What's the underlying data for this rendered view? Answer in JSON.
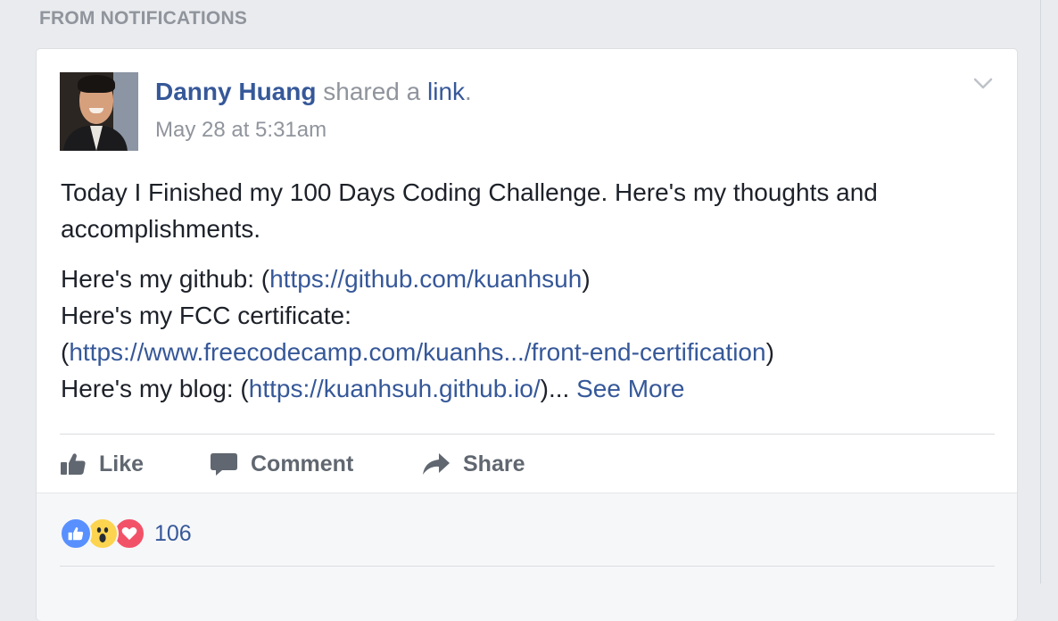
{
  "section": {
    "label": "FROM NOTIFICATIONS"
  },
  "post": {
    "author": "Danny Huang",
    "action_text": "shared a",
    "action_link": "link",
    "action_end": ".",
    "timestamp": "May 28 at 5:31am",
    "paragraph_1": "Today I Finished my 100 Days Coding Challenge. Here's my thoughts and accomplishments.",
    "line_github_prefix": "Here's my github: (",
    "github_url": "https://github.com/kuanhsuh",
    "line_github_suffix": ")",
    "line_fcc_prefix": "Here's my FCC certificate:",
    "fcc_open": "(",
    "fcc_url": "https://www.freecodecamp.com/kuanhs.../front-end-certification",
    "fcc_close": ")",
    "line_blog_prefix": "Here's my blog: (",
    "blog_url": "https://kuanhsuh.github.io/",
    "line_blog_suffix": ")...",
    "see_more": "See More"
  },
  "actions": {
    "like": "Like",
    "comment": "Comment",
    "share": "Share"
  },
  "reactions": {
    "types": [
      "like",
      "wow",
      "love"
    ],
    "count": "106",
    "colors": {
      "like": "#5890ff",
      "wow": "#fcd44f",
      "love": "#f25268"
    }
  },
  "colors": {
    "link": "#365899",
    "muted": "#90949c",
    "text": "#1d2129",
    "background": "#e9ebee"
  },
  "icons": {
    "options": "chevron-down-icon",
    "like": "thumbs-up-icon",
    "comment": "speech-bubble-icon",
    "share": "share-arrow-icon"
  }
}
